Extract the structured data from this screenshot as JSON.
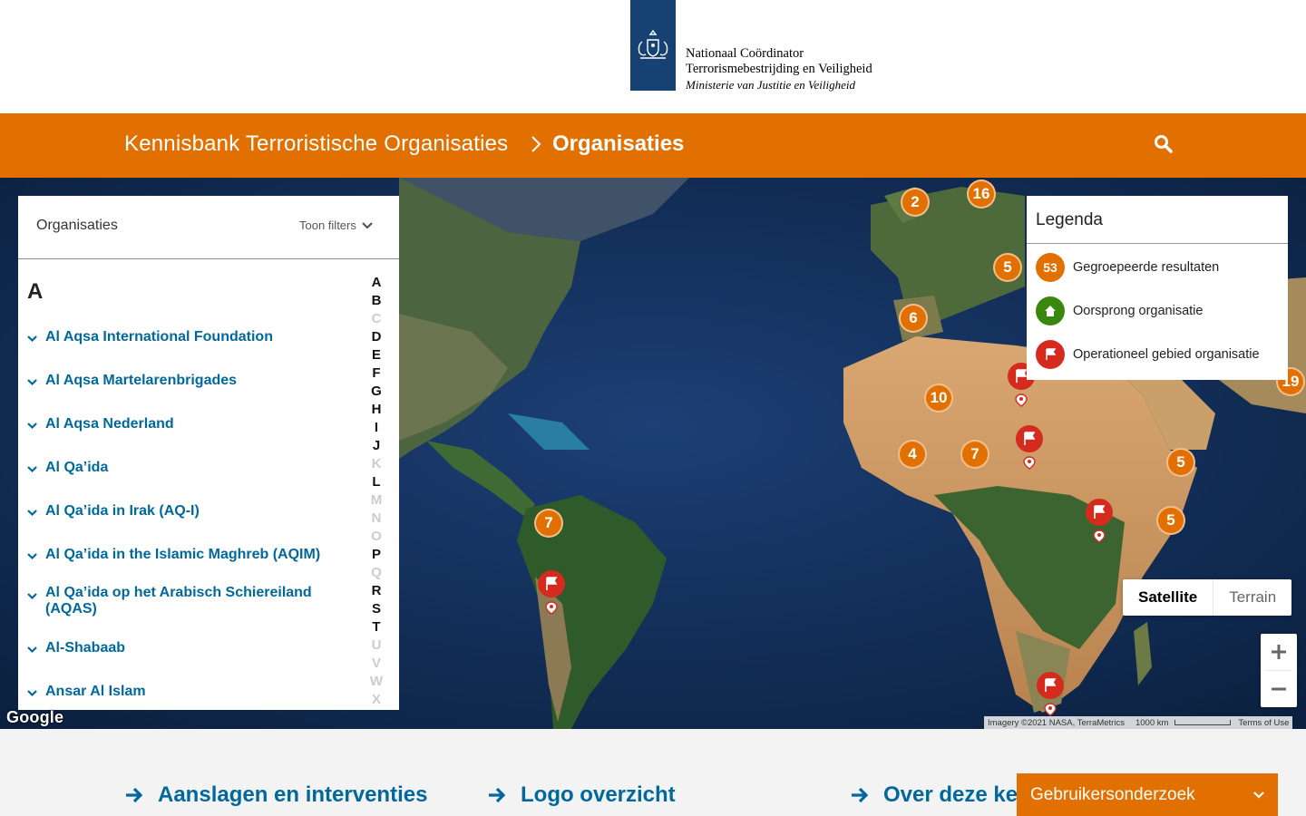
{
  "header": {
    "logo_line1": "Nationaal Coördinator",
    "logo_line2": "Terrorismebestrijding en Veiligheid",
    "logo_line3": "Ministerie van Justitie en Veiligheid"
  },
  "navbar": {
    "breadcrumb_root": "Kennisbank Terroristische Organisaties",
    "breadcrumb_current": "Organisaties",
    "search_icon": "search-icon"
  },
  "panel": {
    "title": "Organisaties",
    "filter_toggle": "Toon filters",
    "letter": "A",
    "items": [
      "Al Aqsa International Foundation",
      "Al Aqsa Martelarenbrigades",
      "Al Aqsa Nederland",
      "Al Qa’ida",
      "Al Qa’ida in Irak (AQ-I)",
      "Al Qa’ida in the Islamic Maghreb (AQIM)",
      "Al Qa’ida op het Arabisch Schiereiland (AQAS)",
      "Al-Shabaab",
      "Ansar Al Islam"
    ],
    "alphabet": [
      {
        "l": "A",
        "on": true
      },
      {
        "l": "B",
        "on": true
      },
      {
        "l": "C",
        "on": false
      },
      {
        "l": "D",
        "on": true
      },
      {
        "l": "E",
        "on": true
      },
      {
        "l": "F",
        "on": true
      },
      {
        "l": "G",
        "on": true
      },
      {
        "l": "H",
        "on": true
      },
      {
        "l": "I",
        "on": true
      },
      {
        "l": "J",
        "on": true
      },
      {
        "l": "K",
        "on": false
      },
      {
        "l": "L",
        "on": true
      },
      {
        "l": "M",
        "on": false
      },
      {
        "l": "N",
        "on": false
      },
      {
        "l": "O",
        "on": false
      },
      {
        "l": "P",
        "on": true
      },
      {
        "l": "Q",
        "on": false
      },
      {
        "l": "R",
        "on": true
      },
      {
        "l": "S",
        "on": true
      },
      {
        "l": "T",
        "on": true
      },
      {
        "l": "U",
        "on": false
      },
      {
        "l": "V",
        "on": false
      },
      {
        "l": "W",
        "on": false
      },
      {
        "l": "X",
        "on": false
      }
    ]
  },
  "legend": {
    "title": "Legenda",
    "grouped_count": "53",
    "grouped_label": "Gegroepeerde resultaten",
    "origin_label": "Oorsprong organisatie",
    "operational_label": "Operationeel gebied organisatie"
  },
  "map": {
    "clusters": [
      "2",
      "16",
      "5",
      "6",
      "10",
      "4",
      "7",
      "5",
      "5",
      "7",
      "19"
    ],
    "type_satellite": "Satellite",
    "type_terrain": "Terrain",
    "google": "Google",
    "imagery": "Imagery ©2021 NASA, TerraMetrics",
    "scale": "1000 km",
    "terms": "Terms of Use"
  },
  "footer": {
    "link1": "Aanslagen en interventies",
    "link2": "Logo overzicht",
    "link3": "Over deze ke",
    "survey": "Gebruikersonderzoek"
  },
  "colors": {
    "orange": "#e17000",
    "link_blue": "#01689b",
    "logo_blue": "#154273",
    "origin_green": "#39870c",
    "flag_red": "#d52b1e"
  }
}
